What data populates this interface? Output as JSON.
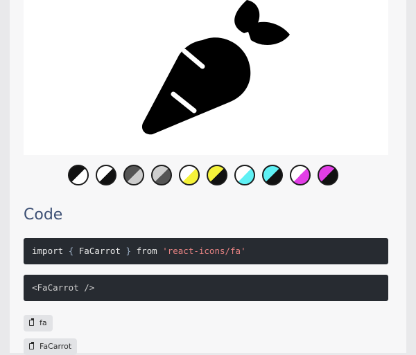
{
  "preview": {
    "icon": "carrot-icon"
  },
  "swatches": [
    {
      "name": "black-white",
      "a": "#111111",
      "b": "#ffffff"
    },
    {
      "name": "white-black",
      "a": "#ffffff",
      "b": "#111111"
    },
    {
      "name": "gray-dark",
      "a": "#555555",
      "b": "#cccccc"
    },
    {
      "name": "lightgray-dark",
      "a": "#cfcfcf",
      "b": "#555555"
    },
    {
      "name": "white-yellow",
      "a": "#ffffff",
      "b": "#f5f23a"
    },
    {
      "name": "yellow-black",
      "a": "#f5f23a",
      "b": "#111111"
    },
    {
      "name": "white-cyan",
      "a": "#ffffff",
      "b": "#5ff0f4"
    },
    {
      "name": "cyan-black",
      "a": "#5ff0f4",
      "b": "#111111"
    },
    {
      "name": "white-magenta",
      "a": "#ffffff",
      "b": "#e23ee6"
    },
    {
      "name": "magenta-black",
      "a": "#e23ee6",
      "b": "#111111"
    }
  ],
  "code": {
    "title": "Code",
    "import_kw": "import",
    "brace_open": "{",
    "component": "FaCarrot",
    "brace_close": "}",
    "from_kw": "from",
    "module": "'react-icons/fa'",
    "jsx": "<FaCarrot />"
  },
  "chips": {
    "chip1": "fa",
    "chip2": "FaCarrot"
  }
}
